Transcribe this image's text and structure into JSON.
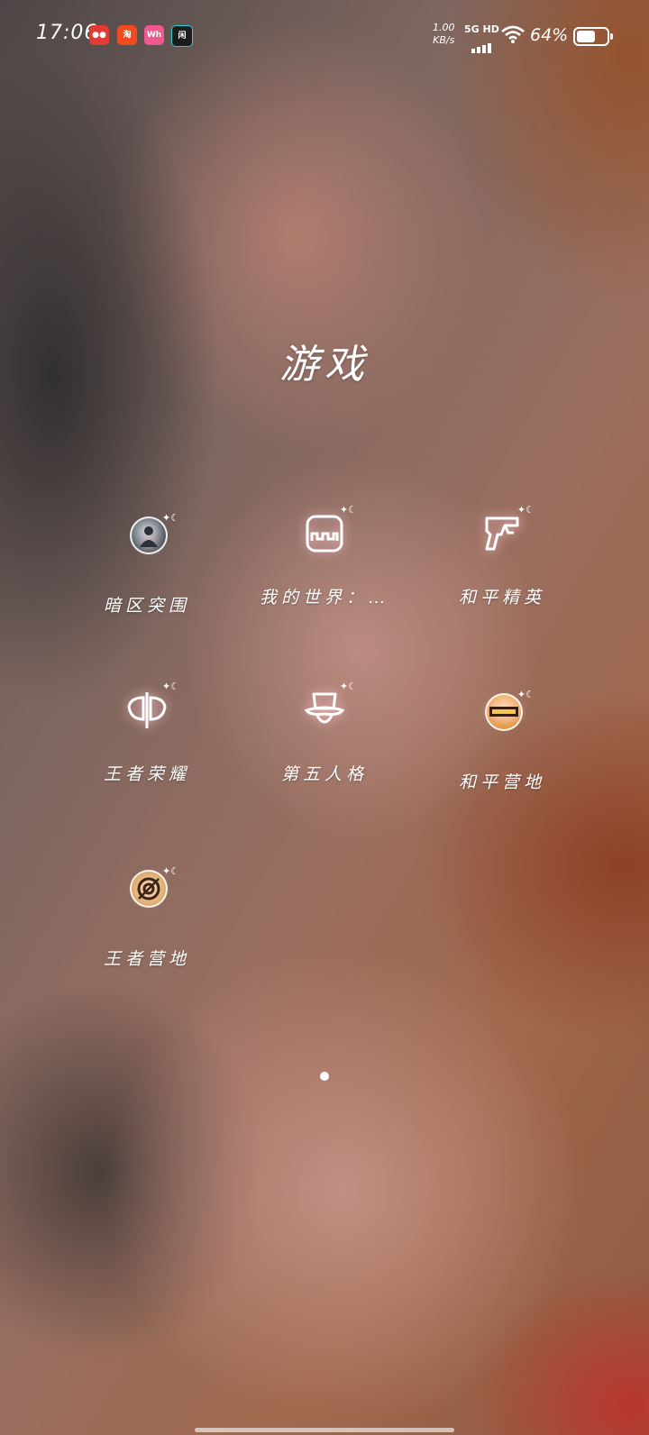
{
  "status_bar": {
    "time": "17:06",
    "notifications": [
      {
        "icon": "red-app-icon",
        "text": "●●"
      },
      {
        "icon": "orange-app-icon",
        "text": "淘"
      },
      {
        "icon": "pink-app-icon",
        "text": "Wh"
      },
      {
        "icon": "dark-app-icon",
        "text": "闲"
      }
    ],
    "net_speed_value": "1.00",
    "net_speed_unit": "KB/s",
    "network": "5G HD",
    "battery_percent": "64%",
    "battery_level": 0.64
  },
  "folder": {
    "title": "游戏",
    "apps": [
      {
        "label": "暗区突围",
        "icon": "soldier-avatar-icon"
      },
      {
        "label": "我的世界：…",
        "icon": "minecraft-block-icon"
      },
      {
        "label": "和平精英",
        "icon": "pubg-gun-icon"
      },
      {
        "label": "王者荣耀",
        "icon": "honor-axe-icon"
      },
      {
        "label": "第五人格",
        "icon": "top-hat-icon"
      },
      {
        "label": "和平营地",
        "icon": "peace-camp-icon"
      },
      {
        "label": "王者营地",
        "icon": "king-camp-icon"
      }
    ],
    "badge": "✦☾"
  },
  "pager": {
    "current_page": 1,
    "total_pages": 1
  }
}
